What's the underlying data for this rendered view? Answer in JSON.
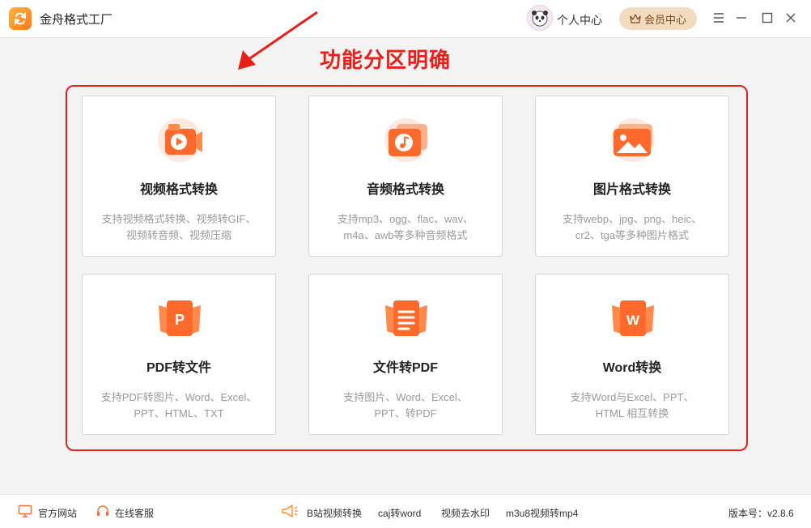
{
  "titlebar": {
    "app_title": "金舟格式工厂",
    "user_center": "个人中心",
    "vip_label": "会员中心"
  },
  "annotation": {
    "text": "功能分区明确",
    "color": "#e8201a"
  },
  "cards": [
    {
      "title": "视频格式转换",
      "desc1": "支持视频格式转换、视频转GIF、",
      "desc2": "视频转音频、视频压缩",
      "icon": "video-icon"
    },
    {
      "title": "音频格式转换",
      "desc1": "支持mp3、ogg、flac、wav、",
      "desc2": "m4a、awb等多种音频格式",
      "icon": "audio-icon"
    },
    {
      "title": "图片格式转换",
      "desc1": "支持webp、jpg、png、heic、",
      "desc2": "cr2、tga等多种图片格式",
      "icon": "image-icon"
    },
    {
      "title": "PDF转文件",
      "desc1": "支持PDF转图片、Word、Excel、",
      "desc2": "PPT、HTML、TXT",
      "icon": "pdf-icon"
    },
    {
      "title": "文件转PDF",
      "desc1": "支持图片、Word、Excel、",
      "desc2": "PPT、转PDF",
      "icon": "file-icon"
    },
    {
      "title": "Word转换",
      "desc1": "支持Word与Excel、PPT、",
      "desc2": "HTML 相互转换",
      "icon": "word-icon"
    }
  ],
  "footer": {
    "website": "官方网站",
    "service": "在线客服",
    "link1": "B站视频转换",
    "link2": "caj转word",
    "link3": "视频去水印",
    "link4": "m3u8视频转mp4",
    "version": "版本号：v2.8.6"
  },
  "colors": {
    "accent": "#ff6a2c",
    "vip_bg": "#f2dcc0",
    "highlight": "#e8201a"
  }
}
